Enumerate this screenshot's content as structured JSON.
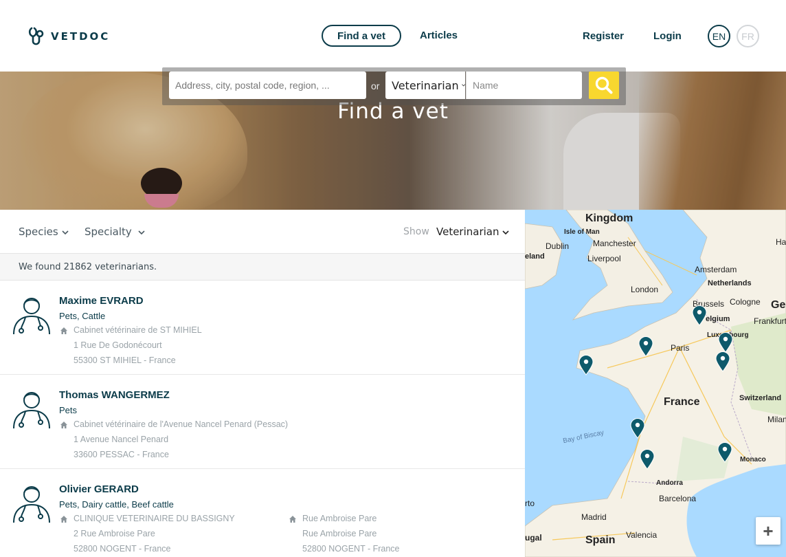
{
  "header": {
    "logo_text": "VETDOC",
    "nav": {
      "find_vet": "Find a vet",
      "articles": "Articles",
      "register": "Register",
      "login": "Login"
    },
    "languages": {
      "en": "EN",
      "fr": "FR"
    }
  },
  "hero": {
    "title": "Find a vet",
    "address_placeholder": "Address, city, postal code, region, ...",
    "or_label": "or",
    "type_selected": "Veterinarian",
    "name_placeholder": "Name"
  },
  "filters": {
    "species": "Species",
    "specialty": "Specialty",
    "show_label": "Show",
    "show_value": "Veterinarian"
  },
  "results": {
    "found_text": "We found 21862 veterinarians."
  },
  "vets": [
    {
      "name": "Maxime EVRARD",
      "species": "Pets,  Cattle",
      "clinics": [
        {
          "name": "Cabinet vétérinaire de ST MIHIEL",
          "street": "1 Rue De Godonécourt",
          "city": "55300 ST MIHIEL - France"
        }
      ]
    },
    {
      "name": "Thomas WANGERMEZ",
      "species": "Pets",
      "clinics": [
        {
          "name": "Cabinet vétérinaire de l'Avenue Nancel Penard (Pessac)",
          "street": "1 Avenue Nancel Penard",
          "city": "33600 PESSAC - France"
        }
      ]
    },
    {
      "name": "Olivier GERARD",
      "species": "Pets,  Dairy cattle,  Beef cattle",
      "clinics": [
        {
          "name": "CLINIQUE VETERINAIRE DU BASSIGNY",
          "street": "2 Rue Ambroise Pare",
          "city": "52800 NOGENT - France"
        },
        {
          "name": "Rue Ambroise Pare",
          "street": "Rue Ambroise Pare",
          "city": "52800 NOGENT - France"
        }
      ]
    }
  ],
  "map": {
    "labels": {
      "kingdom": "Kingdom",
      "isle_of_man": "Isle of Man",
      "dublin": "Dublin",
      "manchester": "Manchester",
      "liverpool": "Liverpool",
      "eland": "eland",
      "amsterdam": "Amsterdam",
      "netherlands": "Netherlands",
      "london": "London",
      "brussels": "Brussels",
      "cologne": "Cologne",
      "ge": "Ge",
      "belgium": "elgium",
      "frankfurt": "Frankfurt",
      "luxembourg": "Luxembourg",
      "paris": "Paris",
      "france": "France",
      "switzerland": "Switzerland",
      "milan": "Milan",
      "bay_of_biscay": "Bay of Biscay",
      "monaco": "Monaco",
      "andorra": "Andorra",
      "barcelona": "Barcelona",
      "madrid": "Madrid",
      "valencia": "Valencia",
      "spain": "Spain",
      "ugal": "ugal",
      "rto": "rto",
      "han": "Han"
    },
    "zoom_in": "+",
    "pin_color": "#0e5a6b",
    "land_color": "#f5f1e6"
  },
  "colors": {
    "brand": "#0b3b49",
    "search_button": "#f8d72f"
  }
}
